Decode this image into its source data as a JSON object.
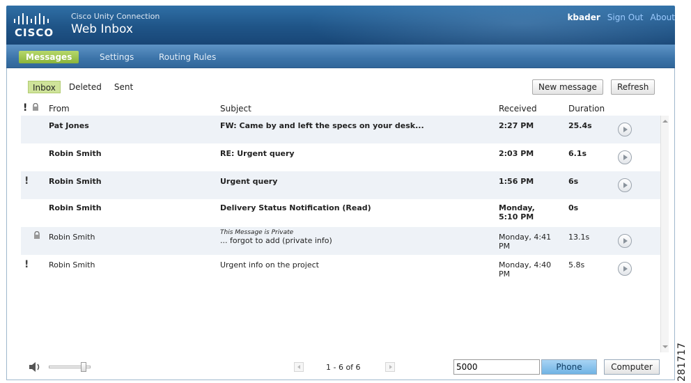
{
  "header": {
    "logo_text": "CISCO",
    "product_name": "Cisco Unity Connection",
    "app_title": "Web Inbox",
    "user_name": "kbader",
    "sign_out_label": "Sign Out",
    "about_label": "About"
  },
  "nav": {
    "tabs": [
      {
        "label": "Messages",
        "active": true
      },
      {
        "label": "Settings",
        "active": false
      },
      {
        "label": "Routing Rules",
        "active": false
      }
    ]
  },
  "folders": {
    "tabs": [
      {
        "label": "Inbox",
        "active": true
      },
      {
        "label": "Deleted",
        "active": false
      },
      {
        "label": "Sent",
        "active": false
      }
    ]
  },
  "toolbar": {
    "new_message_label": "New message",
    "refresh_label": "Refresh"
  },
  "columns": {
    "priority_mark": "!",
    "from": "From",
    "subject": "Subject",
    "received": "Received",
    "duration": "Duration"
  },
  "messages": [
    {
      "urgent": false,
      "private": false,
      "unread": true,
      "from": "Pat Jones",
      "private_note": "",
      "subject": "FW: Came by and left the specs on your desk...",
      "received": "2:27 PM",
      "duration": "25.4s",
      "has_audio": true
    },
    {
      "urgent": false,
      "private": false,
      "unread": true,
      "from": "Robin Smith",
      "private_note": "",
      "subject": "RE: Urgent query",
      "received": "2:03 PM",
      "duration": "6.1s",
      "has_audio": true
    },
    {
      "urgent": true,
      "private": false,
      "unread": true,
      "from": "Robin Smith",
      "private_note": "",
      "subject": "Urgent query",
      "received": "1:56 PM",
      "duration": "6s",
      "has_audio": true
    },
    {
      "urgent": false,
      "private": false,
      "unread": true,
      "from": "Robin Smith",
      "private_note": "",
      "subject": "Delivery Status Notification (Read)",
      "received": "Monday, 5:10 PM",
      "duration": "0s",
      "has_audio": false
    },
    {
      "urgent": false,
      "private": true,
      "unread": false,
      "from": "Robin Smith",
      "private_note": "This Message is Private",
      "subject": "... forgot to add (private info)",
      "received": "Monday, 4:41 PM",
      "duration": "13.1s",
      "has_audio": true
    },
    {
      "urgent": true,
      "private": false,
      "unread": false,
      "from": "Robin Smith",
      "private_note": "",
      "subject": "Urgent info on the project",
      "received": "Monday, 4:40 PM",
      "duration": "5.8s",
      "has_audio": true
    }
  ],
  "footer": {
    "volume_level": 0.85,
    "pager_text": "1 - 6 of 6",
    "phone_number": "5000",
    "phone_label": "Phone",
    "computer_label": "Computer"
  },
  "figure_number": "281717"
}
